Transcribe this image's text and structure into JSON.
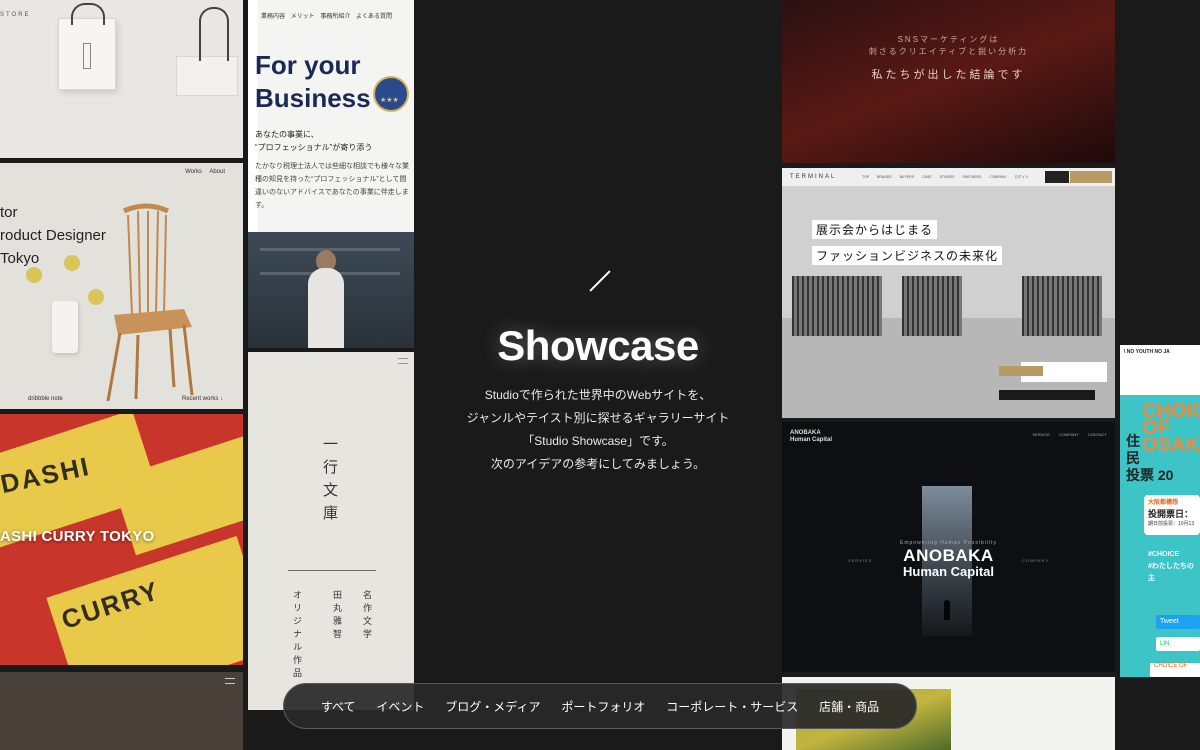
{
  "hero": {
    "brand": "Showcase",
    "description_lines": [
      "Studioで作られた世界中のWebサイトを、",
      "ジャンルやテイスト別に探せるギャラリーサイト",
      "「Studio Showcase」です。",
      "次のアイデアの参考にしてみましょう。"
    ]
  },
  "filters": [
    "すべて",
    "イベント",
    "ブログ・メディア",
    "ポートフォリオ",
    "コーポレート・サービス",
    "店舗・商品"
  ],
  "cards": {
    "store": {
      "label": "STORE"
    },
    "designer": {
      "nav": "Works About",
      "headline": [
        "tor",
        "roduct Designer",
        "Tokyo"
      ],
      "links": "dribbble  note",
      "recent": "Recent works ↓"
    },
    "curry": {
      "title": "ASHI CURRY TOKYO",
      "bigtext1": "DASHI",
      "bigtext2": "CURRY"
    },
    "tax": {
      "nav": "業務内容  メリット  事務所紹介  よくある質問",
      "title_line1": "For your",
      "title_line2": "Business",
      "sub_line1": "あなたの事業に、",
      "sub_line2": "“プロフェッショナル”が寄り添う",
      "body": "たかなり税理士法人では些細な相談でも様々な業種の知見を持った“プロフェッショナル”として間違いのないアドバイスであなたの事業に伴走します。"
    },
    "bunko": {
      "title": "一行文庫",
      "col1": "名作文学",
      "col2": "田丸雅智",
      "col3": "オリジナル作品"
    },
    "sns": {
      "t1_line1": "SNSマーケティングは",
      "t1_line2": "刺さるクリエイティブと鋭い分析力",
      "t2": "私たちが出した結論です"
    },
    "terminal": {
      "logo": "TERMINAL",
      "nav": "TOP BRANDS BUYERS CASE STUDIES PARTNERS COMPANY ログイン",
      "headline1": "展示会からはじまる",
      "headline2": "ファッションビジネスの未来化"
    },
    "anobaka": {
      "logo_line1": "ANOBAKA",
      "logo_line2": "Human Capital",
      "nav": "SERVICE COMPANY CONTACT",
      "tagline": "Empowering Human Possibility",
      "big1": "ANOBAKA",
      "big2": "Human Capital",
      "left": "SERVICE",
      "right": "COMPANY"
    },
    "osaka": {
      "top": "\\ NO YOUTH NO JA",
      "choice": "CHOICE OF OSAKA",
      "jumin_line1": "住",
      "jumin_line2": "民",
      "jumin_line3": "投票 20",
      "box1": "大阪都構想",
      "box2": "投開票日：",
      "box3": "期日前投票：10月13",
      "hash1": "#CHOICE",
      "hash2": "#わたしたちの主",
      "tweet": "Tweet",
      "line": "LIN",
      "foot": "CHOICE OF"
    }
  }
}
